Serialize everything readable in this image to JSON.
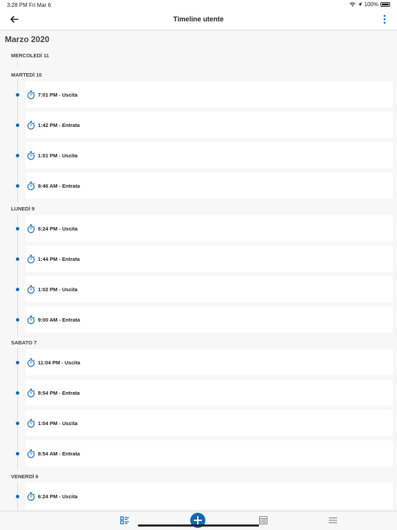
{
  "status_bar": {
    "time": "3:28 PM",
    "date": "Fri Mar 6",
    "battery": "100%"
  },
  "nav": {
    "title": "Timeline utente",
    "back_icon": "arrow-left-icon",
    "more_icon": "more-vertical-icon"
  },
  "month": "Marzo 2020",
  "days": [
    {
      "label": "MERCOLEDÌ 11",
      "entries": []
    },
    {
      "label": "MARTEDÌ 10",
      "entries": [
        "7:01 PM - Uscita",
        "1:42 PM - Entrata",
        "1:01 PM - Uscita",
        "8:46 AM - Entrata"
      ]
    },
    {
      "label": "LUNEDÌ 9",
      "entries": [
        "6:24 PM - Uscita",
        "1:44 PM - Entrata",
        "1:02 PM - Uscita",
        "9:00 AM - Entrata"
      ]
    },
    {
      "label": "SABATO 7",
      "entries": [
        "11:04 PM - Uscita",
        "8:54 PM - Entrata",
        "1:04 PM - Uscita",
        "8:54 AM - Entrata"
      ]
    },
    {
      "label": "VENERDÌ 6",
      "entries": [
        "6:24 PM - Uscita"
      ]
    }
  ],
  "colors": {
    "accent": "#1168b3",
    "background": "#f7f7f7"
  },
  "tabs": [
    {
      "name": "timeline-tab",
      "icon": "list-icon",
      "active": true
    },
    {
      "name": "add-button",
      "icon": "plus-icon"
    },
    {
      "name": "calendar-tab",
      "icon": "calendar-grid-icon"
    },
    {
      "name": "menu-tab",
      "icon": "menu-icon"
    }
  ]
}
